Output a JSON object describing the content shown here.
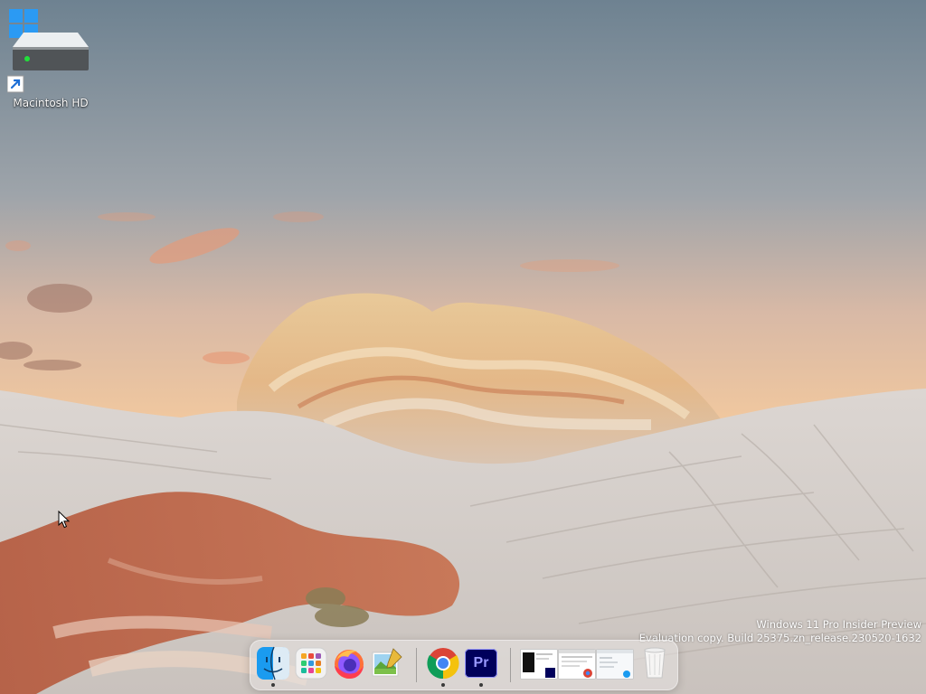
{
  "desktop": {
    "icons": [
      {
        "label": "Macintosh HD",
        "icon": "hard-drive-icon",
        "shortcut": true
      }
    ]
  },
  "watermark": {
    "line1": "Windows 11 Pro Insider Preview",
    "line2": "Evaluation copy. Build 25375.zn_release.230520-1632"
  },
  "dock": {
    "items": [
      {
        "name": "Finder",
        "icon": "finder-icon",
        "running": true
      },
      {
        "name": "Launchpad",
        "icon": "launchpad-icon",
        "running": false
      },
      {
        "name": "Firefox",
        "icon": "firefox-icon",
        "running": false
      },
      {
        "name": "Image Editor",
        "icon": "image-editor-icon",
        "running": false
      },
      {
        "name": "Google Chrome",
        "icon": "chrome-icon",
        "running": true
      },
      {
        "name": "Adobe Premiere Pro",
        "icon": "premiere-icon",
        "label": "Pr",
        "running": true
      },
      {
        "name": "Window Preview 1",
        "icon": "window-thumbnail",
        "running": false
      },
      {
        "name": "Window Preview 2",
        "icon": "window-thumbnail",
        "running": false
      },
      {
        "name": "Window Preview 3",
        "icon": "window-thumbnail",
        "running": false
      },
      {
        "name": "Trash",
        "icon": "trash-icon",
        "running": false
      }
    ]
  },
  "colors": {
    "sky_top": "#6f8391",
    "sky_bottom": "#f3c99c",
    "rock_light": "#e3ddd8",
    "rock_red": "#b85a3c",
    "premiere_bg": "#00005b",
    "premiere_text": "#9999ff"
  }
}
